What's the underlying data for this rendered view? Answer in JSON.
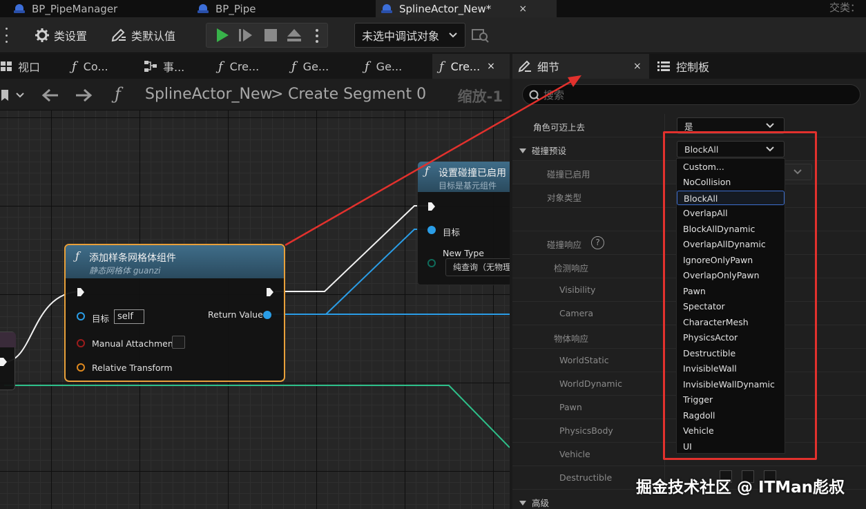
{
  "doc_tabs": [
    "BP_PipeManager",
    "BP_Pipe",
    "SplineActor_New*"
  ],
  "doc_tab_close": "×",
  "corner_text": "交类：",
  "toolbar": {
    "class_settings": "类设置",
    "class_defaults": "类默认值",
    "debug_select": "未选中调试对象"
  },
  "graph_tabs": [
    {
      "label": "视口"
    },
    {
      "label": "Co..."
    },
    {
      "label": "事..."
    },
    {
      "label": "Cre..."
    },
    {
      "label": "Ge..."
    },
    {
      "label": "Ge..."
    },
    {
      "label": "Cre..."
    }
  ],
  "graph_tab_close": "×",
  "fx_glyph": "ƒ",
  "breadcrumb": {
    "root": "SplineActor_New",
    "separator": ">",
    "current": "Create Segment 0",
    "zoom": "缩放-1"
  },
  "node_add_spline": {
    "title": "添加样条网格体组件",
    "subtitle": "静态网格体 guanzi",
    "target_label": "目标",
    "target_value": "self",
    "return_value": "Return Value",
    "manual_attachment": "Manual Attachment",
    "relative_transform": "Relative Transform"
  },
  "node_set_collision": {
    "title": "设置碰撞已启用",
    "subtitle": "目标是基元组件",
    "target_label": "目标",
    "new_type": "New Type",
    "new_type_value": "纯查询（无物理"
  },
  "details": {
    "tab_details": "细节",
    "tab_close": "×",
    "tab_palette": "控制板",
    "search_placeholder": "搜索",
    "rows": [
      {
        "label": "角色可迈上去",
        "value": "是"
      },
      {
        "label": "碰撞预设",
        "value": "BlockAll"
      },
      {
        "label": "碰撞已启用",
        "value": ")"
      },
      {
        "label": "对象类型"
      },
      {
        "label": ""
      },
      {
        "label": "碰撞响应"
      },
      {
        "label": "检测响应"
      },
      {
        "label": "Visibility"
      },
      {
        "label": "Camera"
      },
      {
        "label": "物体响应"
      },
      {
        "label": "WorldStatic"
      },
      {
        "label": "WorldDynamic"
      },
      {
        "label": "Pawn"
      },
      {
        "label": "PhysicsBody"
      },
      {
        "label": "Vehicle"
      },
      {
        "label": "Destructible"
      },
      {
        "label": "高级"
      }
    ],
    "help": "?"
  },
  "dropdown": {
    "options": [
      "Custom...",
      "NoCollision",
      "BlockAll",
      "OverlapAll",
      "BlockAllDynamic",
      "OverlapAllDynamic",
      "IgnoreOnlyPawn",
      "OverlapOnlyPawn",
      "Pawn",
      "Spectator",
      "CharacterMesh",
      "PhysicsActor",
      "Destructible",
      "InvisibleWall",
      "InvisibleWallDynamic",
      "Trigger",
      "Ragdoll",
      "Vehicle",
      "UI"
    ],
    "selected": "BlockAll"
  },
  "watermark": "掘金技术社区 @ ITMan彪叔",
  "colors": {
    "accent_blue": "#3d6fd0",
    "annotation_red": "#e2312d",
    "node_border_orange": "#e8a03a",
    "wire_exec": "#f2f2f2",
    "wire_object": "#2a9de6",
    "wire_struct": "#2ec08a"
  }
}
